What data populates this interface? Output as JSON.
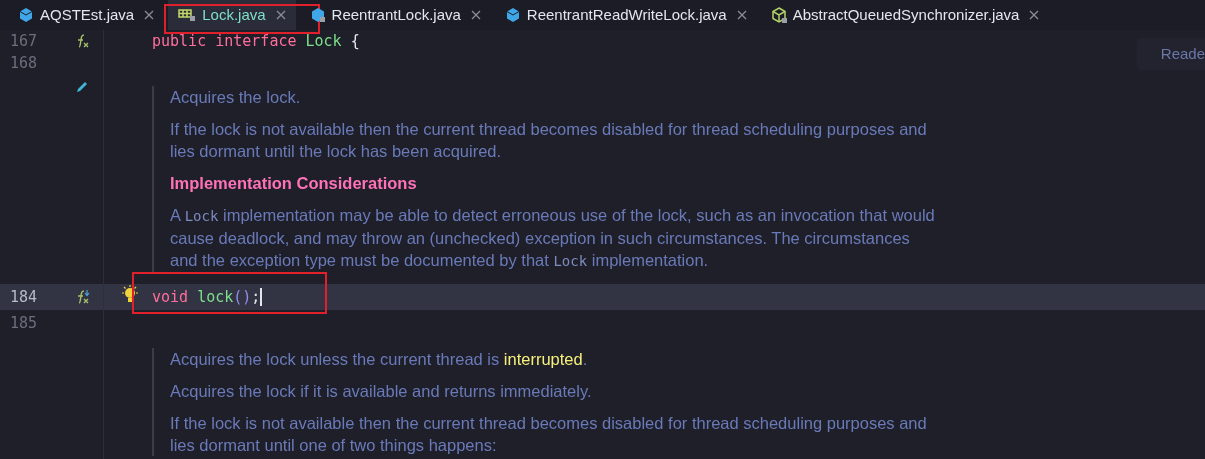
{
  "tabs": [
    {
      "label": "AQSTEst.java",
      "kind": "class",
      "selected": false,
      "marked": false
    },
    {
      "label": "Lock.java",
      "kind": "interface",
      "selected": true,
      "marked": true
    },
    {
      "label": "ReentrantLock.java",
      "kind": "locked-class",
      "selected": false,
      "marked": false
    },
    {
      "label": "ReentrantReadWriteLock.java",
      "kind": "class",
      "selected": false,
      "marked": false
    },
    {
      "label": "AbstractQueuedSynchronizer.java",
      "kind": "abstract",
      "selected": false,
      "marked": false
    }
  ],
  "reader_mode": "Reade",
  "lines": [
    {
      "kind": "code",
      "number": "167",
      "gutter": {
        "kind": "fx"
      },
      "code": [
        {
          "text": "public ",
          "kind": "keyword"
        },
        {
          "text": "interface ",
          "kind": "keyword"
        },
        {
          "text": "Lock ",
          "kind": "type"
        },
        {
          "text": "{",
          "kind": "punct"
        }
      ],
      "current": false,
      "marked": false
    },
    {
      "kind": "code",
      "number": "168",
      "current": false,
      "marked": false
    },
    {
      "kind": "doc",
      "gutter": {
        "kind": "pencil"
      },
      "paragraphs": [
        [
          {
            "text": "Acquires the lock.",
            "kind": "plain"
          }
        ],
        [
          {
            "text": "If the lock is not available then the current thread becomes disabled for thread scheduling purposes and lies dormant until the lock has been acquired.",
            "kind": "plain"
          }
        ],
        [
          {
            "text": "Implementation Considerations",
            "kind": "heading"
          }
        ],
        [
          {
            "text": "A ",
            "kind": "plain"
          },
          {
            "text": "Lock",
            "kind": "code"
          },
          {
            "text": " implementation may be able to detect erroneous use of the lock, such as an invocation that would cause deadlock, and may throw an (unchecked) exception in such circumstances. The circumstances and the exception type must be documented by that ",
            "kind": "plain"
          },
          {
            "text": "Lock",
            "kind": "code"
          },
          {
            "text": " implementation.",
            "kind": "plain"
          }
        ]
      ]
    },
    {
      "kind": "code",
      "number": "184",
      "gutter": {
        "kind": "fx-down"
      },
      "bulb": true,
      "code": [
        {
          "text": "void ",
          "kind": "keyword"
        },
        {
          "text": "lock",
          "kind": "method"
        },
        {
          "text": "()",
          "kind": "paren"
        },
        {
          "text": ";",
          "kind": "punct"
        }
      ],
      "current": true,
      "marked": true
    },
    {
      "kind": "code",
      "number": "185",
      "current": false,
      "marked": false
    },
    {
      "kind": "doc",
      "paragraphs": [
        [
          {
            "text": "Acquires the lock unless the current thread is ",
            "kind": "plain"
          },
          {
            "text": "interrupted",
            "kind": "link"
          },
          {
            "text": ".",
            "kind": "plain"
          }
        ],
        [
          {
            "text": "Acquires the lock if it is available and returns immediately.",
            "kind": "plain"
          }
        ],
        [
          {
            "text": "If the lock is not available then the current thread becomes disabled for thread scheduling purposes and lies dormant until one of two things happens:",
            "kind": "plain"
          }
        ]
      ]
    }
  ]
}
